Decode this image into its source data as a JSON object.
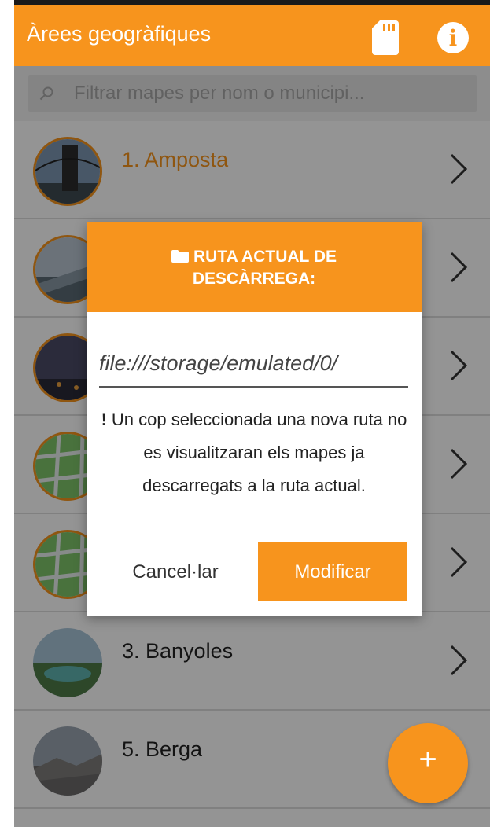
{
  "appbar": {
    "title": "Àrees geogràfiques",
    "sd_icon": "sd-card-icon",
    "info_icon": "info-icon"
  },
  "search": {
    "placeholder": "Filtrar mapes per nom o municipi...",
    "icon": "search-icon"
  },
  "list": {
    "items": [
      {
        "label": "1. Amposta",
        "active": true
      },
      {
        "label": "",
        "active": false
      },
      {
        "label": "",
        "active": false
      },
      {
        "label": "",
        "active": false
      },
      {
        "label": "",
        "active": false
      },
      {
        "label": "3. Banyoles",
        "active": false
      },
      {
        "label": "5. Berga",
        "active": false
      }
    ],
    "chevron_icon": "chevron-right-icon"
  },
  "fab": {
    "label": "+"
  },
  "dialog": {
    "title": "RUTA ACTUAL DE DESCÀRREGA:",
    "path": "file:///storage/emulated/0/",
    "warning_mark": "!",
    "warning": "Un cop seleccionada una nova ruta no es visualitzaran els mapes ja descarregats a la ruta actual.",
    "cancel_label": "Cancel·lar",
    "modify_label": "Modificar"
  },
  "colors": {
    "accent": "#f7941d",
    "scrim": "rgba(0,0,0,0.42)",
    "divider": "#dddddd"
  }
}
